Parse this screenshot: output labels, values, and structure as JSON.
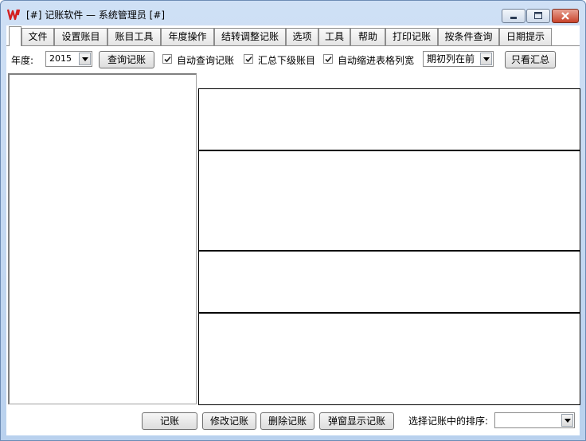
{
  "window": {
    "title": "[#] 记账软件 — 系统管理员 [#]"
  },
  "tabs": [
    "文件",
    "设置账目",
    "账目工具",
    "年度操作",
    "结转调整记账",
    "选项",
    "工具",
    "帮助",
    "打印记账",
    "按条件查询",
    "日期提示"
  ],
  "toolbar": {
    "year_label": "年度:",
    "year_value": "2015",
    "query_button": "查询记账",
    "auto_query": {
      "label": "自动查询记账",
      "checked": true
    },
    "summarize_sub": {
      "label": "汇总下级账目",
      "checked": true
    },
    "auto_shrink": {
      "label": "自动缩进表格列宽",
      "checked": true
    },
    "column_order_value": "期初列在前",
    "summary_only_button": "只看汇总"
  },
  "bottom": {
    "record_button": "记账",
    "edit_button": "修改记账",
    "delete_button": "删除记账",
    "popup_button": "弹窗显示记账",
    "sort_label": "选择记账中的排序:",
    "sort_value": ""
  },
  "colors": {
    "title_bg": "#c4d8f0",
    "close_button": "#c8432b",
    "app_icon": "#d42020"
  }
}
